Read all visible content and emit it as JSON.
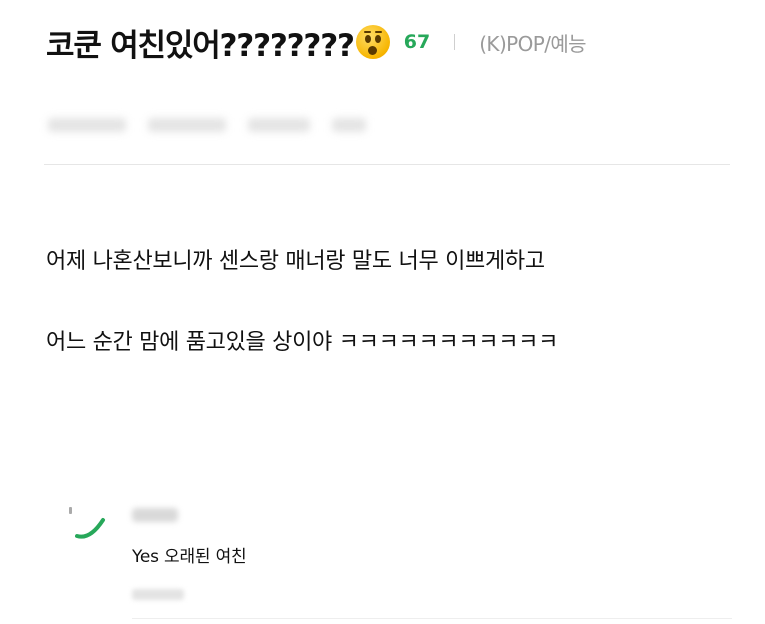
{
  "post": {
    "title": "코쿤 여친있어????????",
    "emoji_icon": "astonished-face-emoji",
    "comment_count": "67",
    "category": "(K)POP/예능",
    "body_lines": [
      "어제 나혼산보니까 센스랑 매너랑 말도 너무 이쁘게하고",
      "어느 순간 맘에 품고있을 상이야 ㅋㅋㅋㅋㅋㅋㅋㅋㅋㅋㅋ"
    ]
  },
  "comments": [
    {
      "text": "Yes 오래된 여친"
    }
  ],
  "colors": {
    "accent": "#27a85a",
    "category": "#9a9a9a"
  }
}
